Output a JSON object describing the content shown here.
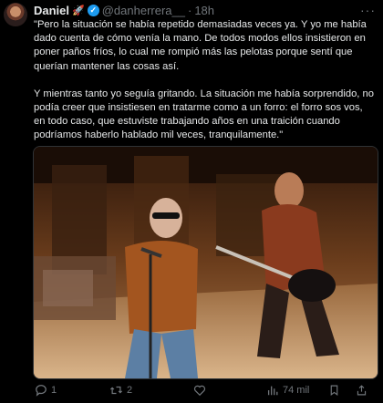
{
  "author": {
    "name": "Daniel",
    "emoji": "🚀",
    "handle": "@danherrera__",
    "separator": "·",
    "time": "18h",
    "more_label": "···"
  },
  "tweet": {
    "paragraph_1": "\"Pero la situación se había repetido demasiadas veces ya. Y yo me había dado cuenta de cómo venía la mano. De todos modos ellos insistieron en poner paños fríos, lo cual me rompió más las pelotas porque sentí que querían mantener las cosas así.",
    "paragraph_2": "Y mientras tanto yo seguía gritando. La situación me había sorprendido, no podía creer que insistiesen en tratarme como a un forro: el forro sos vos, en todo caso, que estuviste trabajando años en una traición cuando podríamos haberlo hablado mil veces, tranquilamente.\""
  },
  "actions": {
    "reply_count": "1",
    "retweet_count": "2",
    "like_count": "",
    "views_count": "74 mil"
  },
  "colors": {
    "verified": "#1d9bf0",
    "muted": "#71767b",
    "text": "#e7e9ea"
  }
}
